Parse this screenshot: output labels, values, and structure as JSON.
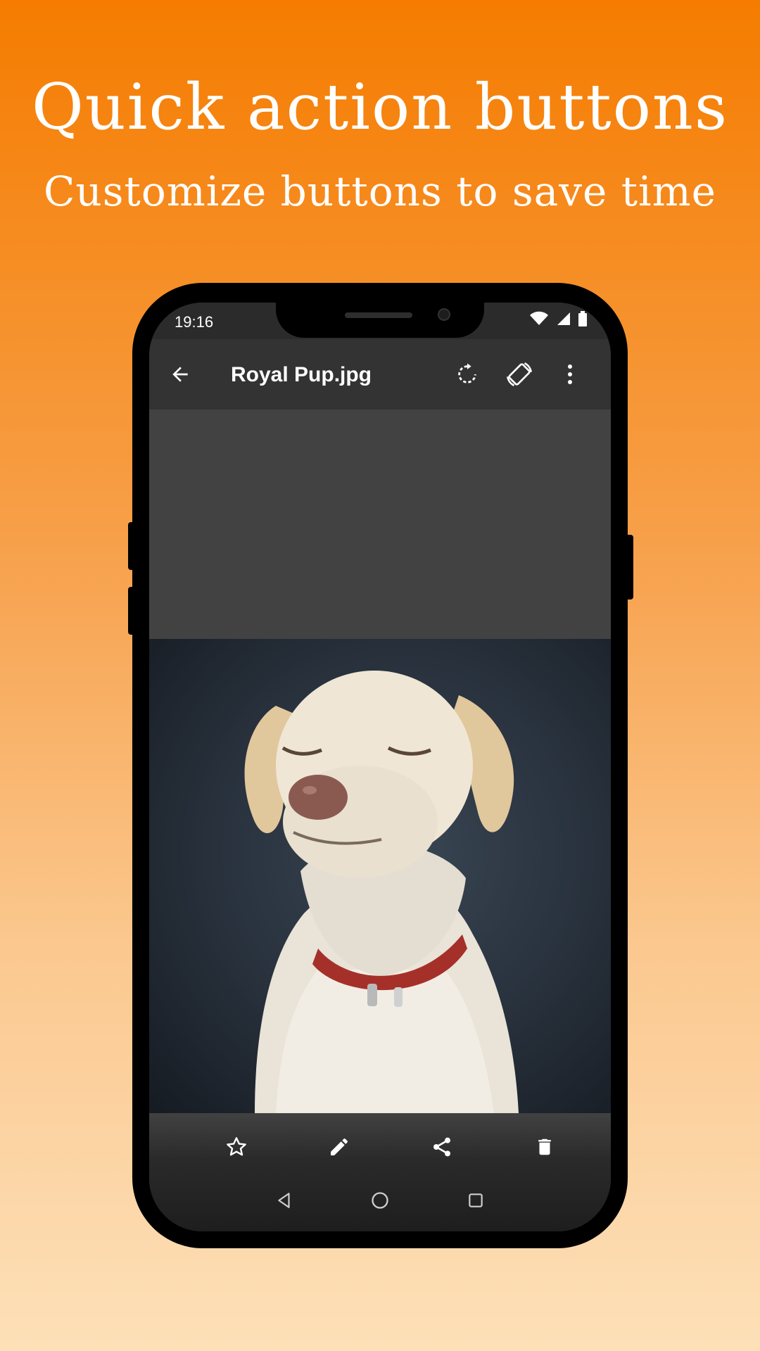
{
  "promo": {
    "headline": "Quick action buttons",
    "subline": "Customize buttons to save time"
  },
  "status_bar": {
    "time": "19:16",
    "icons": [
      "wifi-icon",
      "signal-icon",
      "battery-icon"
    ]
  },
  "toolbar": {
    "title": "Royal Pup.jpg",
    "back_icon": "arrow-back-icon",
    "actions": [
      "rotate-icon",
      "screen-rotation-icon",
      "more-vertical-icon"
    ]
  },
  "image": {
    "subject": "dog-photo"
  },
  "bottom_actions": [
    "star-outline-icon",
    "edit-pencil-icon",
    "share-icon",
    "delete-icon"
  ],
  "nav": [
    "back-triangle-icon",
    "home-circle-icon",
    "recents-square-icon"
  ],
  "colors": {
    "gradient_top": "#f57c00",
    "gradient_bottom": "#fde0b8",
    "screen_bg": "#424242",
    "toolbar_bg": "#333333",
    "phone_frame": "#000000"
  }
}
